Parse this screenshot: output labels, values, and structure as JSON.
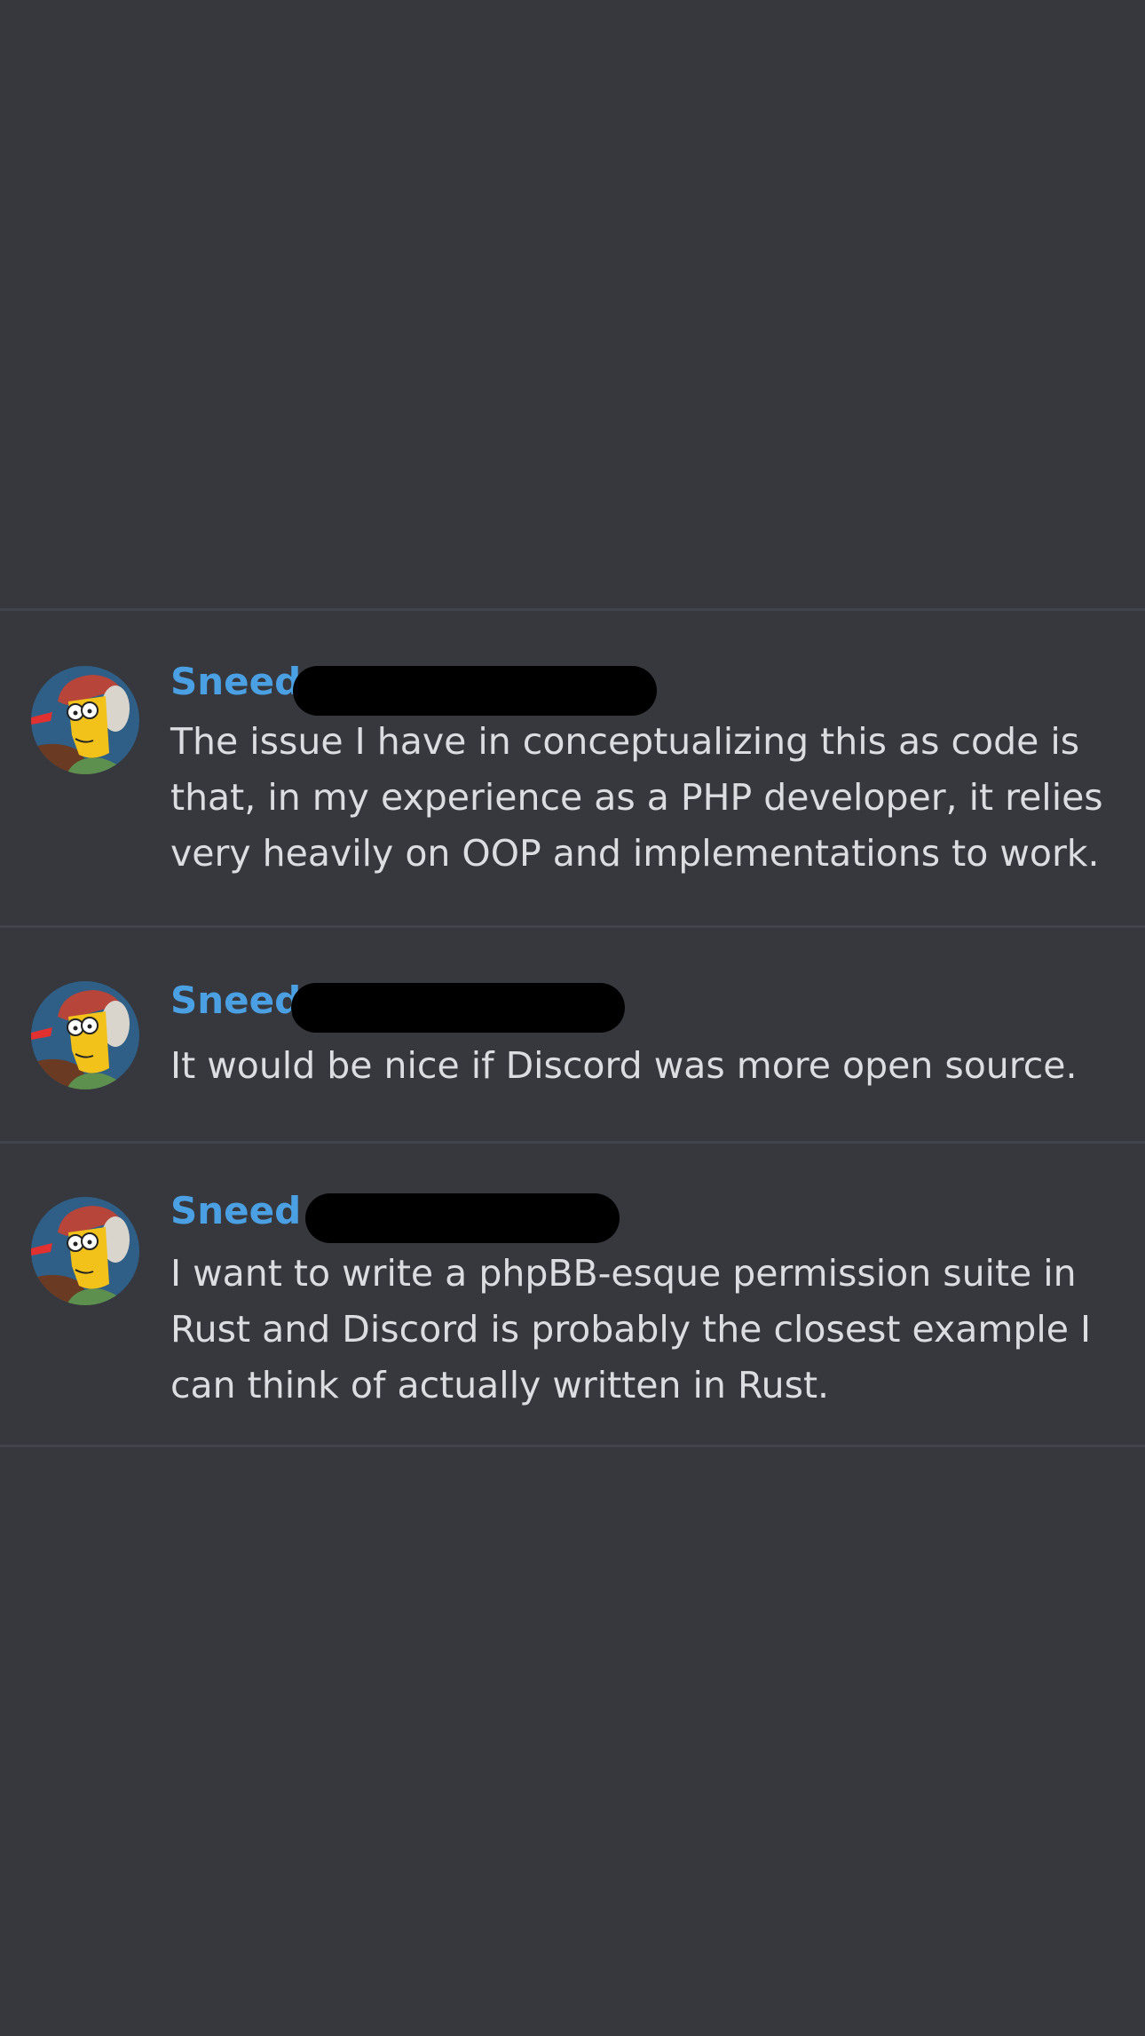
{
  "colors": {
    "background": "#36383e",
    "divider": "#42444b",
    "author_name": "#4aa0e3",
    "message_text": "#dcdde1",
    "redaction": "#000000"
  },
  "messages": [
    {
      "author": "Sneed",
      "avatar_icon": "cartoon-avatar-icon",
      "timestamp_redacted": true,
      "lines": [
        "The issue I have in conceptualizing this as code is",
        "that, in my experience as a PHP developer, it relies",
        "very heavily on OOP and implementations to work."
      ]
    },
    {
      "author": "Sneed",
      "avatar_icon": "cartoon-avatar-icon",
      "timestamp_redacted": true,
      "lines": [
        "It would be nice if Discord was more open source."
      ]
    },
    {
      "author": "Sneed",
      "avatar_icon": "cartoon-avatar-icon",
      "timestamp_redacted": true,
      "lines": [
        "I want to write a phpBB-esque permission suite in",
        "Rust and Discord is probably the closest example I",
        "can think of actually written in Rust."
      ]
    }
  ]
}
